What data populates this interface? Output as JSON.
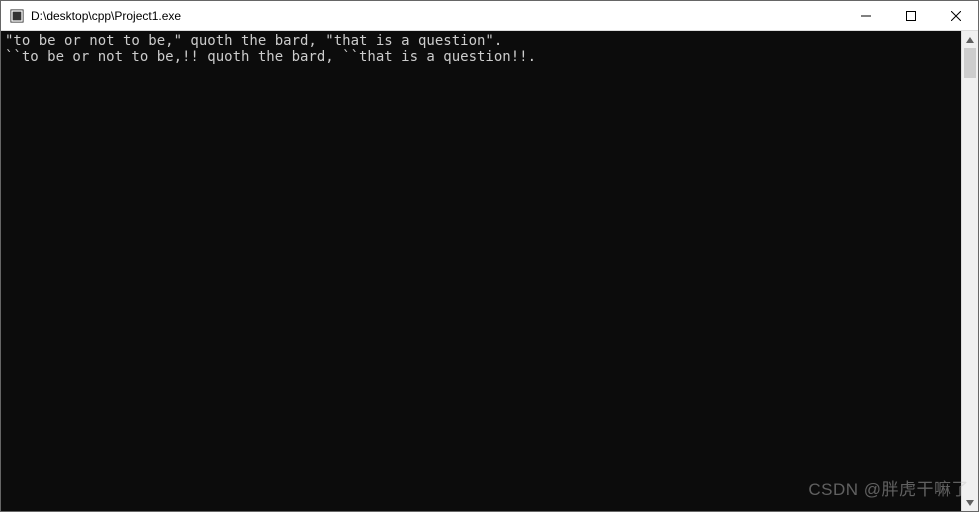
{
  "titlebar": {
    "title": "D:\\desktop\\cpp\\Project1.exe"
  },
  "console": {
    "line1": "\"to be or not to be,\" quoth the bard, \"that is a question\".",
    "line2": "``to be or not to be,!! quoth the bard, ``that is a question!!."
  },
  "watermark": {
    "text": "CSDN @胖虎干嘛了"
  }
}
